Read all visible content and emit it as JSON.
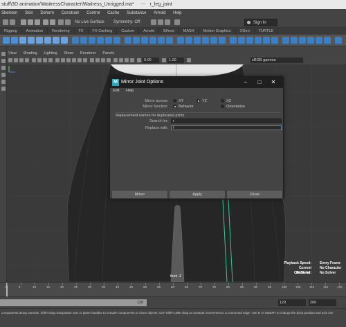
{
  "window": {
    "title": "stuff\\3D animation\\WaitressCharacter\\Waitress_Unrigged.ma*",
    "title_sep": "---",
    "selection": "r_leg_joint"
  },
  "menubar": [
    "Skeleton",
    "Skin",
    "Deform",
    "Constrain",
    "Control",
    "Cache",
    "Substance",
    "Arnold",
    "Help"
  ],
  "statusline": {
    "live_surface": "No Live Surface",
    "symmetry": "Symmetry: Off",
    "signin": "Sign In"
  },
  "shelf_tabs": [
    "Rigging",
    "Animation",
    "Rendering",
    "FX",
    "FX Caching",
    "Custom",
    "Arnold",
    "Bifrost",
    "MASH",
    "Motion Graphics",
    "XGen",
    "TURTLE"
  ],
  "panel_menu": [
    "View",
    "Shading",
    "Lighting",
    "Show",
    "Renderer",
    "Panels"
  ],
  "viewport_toolbar": {
    "value_a": "0.00",
    "value_b": "1.00",
    "color_space": "sRGB gamma"
  },
  "viewport": {
    "camera_label": "front -Z",
    "hud": [
      {
        "key": "Playback Speed:",
        "value": "Every Frame"
      },
      {
        "key": "Current Character:",
        "value": "No Character"
      },
      {
        "key": "IK Blend:",
        "value": "No Solver"
      }
    ]
  },
  "dialog": {
    "title": "Mirror Joint Options",
    "menu": [
      "Edit",
      "Help"
    ],
    "mirror_across_label": "Mirror across:",
    "mirror_across_options": [
      {
        "label": "XY",
        "selected": false
      },
      {
        "label": "YZ",
        "selected": true
      },
      {
        "label": "XZ",
        "selected": false
      }
    ],
    "mirror_function_label": "Mirror function:",
    "mirror_function_options": [
      {
        "label": "Behavior",
        "selected": true
      },
      {
        "label": "Orientation",
        "selected": false
      }
    ],
    "section_header": "Replacement names for duplicated joints",
    "search_for_label": "Search for:",
    "search_for_value": "r",
    "replace_with_label": "Replace with:",
    "replace_with_value": "l",
    "buttons": {
      "mirror": "Mirror",
      "apply": "Apply",
      "close": "Close"
    }
  },
  "timeline": {
    "ticks": [
      "1",
      "5",
      "10",
      "15",
      "20",
      "25",
      "30",
      "35",
      "40",
      "45",
      "50",
      "55",
      "60",
      "65",
      "70",
      "75",
      "80",
      "85",
      "90",
      "95",
      "100",
      "105",
      "110",
      "115",
      "120"
    ],
    "current_frame": 1
  },
  "range": {
    "range_end": "120",
    "end_time": "120",
    "anim_end": "200"
  },
  "helpline": "components along normals. Shift+drag manipulator axis or plane handles to extrude components or clone objects. Ctrl+Shift+LMB+drag to constrain movement to a connected edge. Use D or INSERT to change the pivot position and axis orie",
  "colors": {
    "maya_logo": "#2aa7b8",
    "joint_line": "#35c9a0",
    "active_field_border": "#5285a6"
  }
}
